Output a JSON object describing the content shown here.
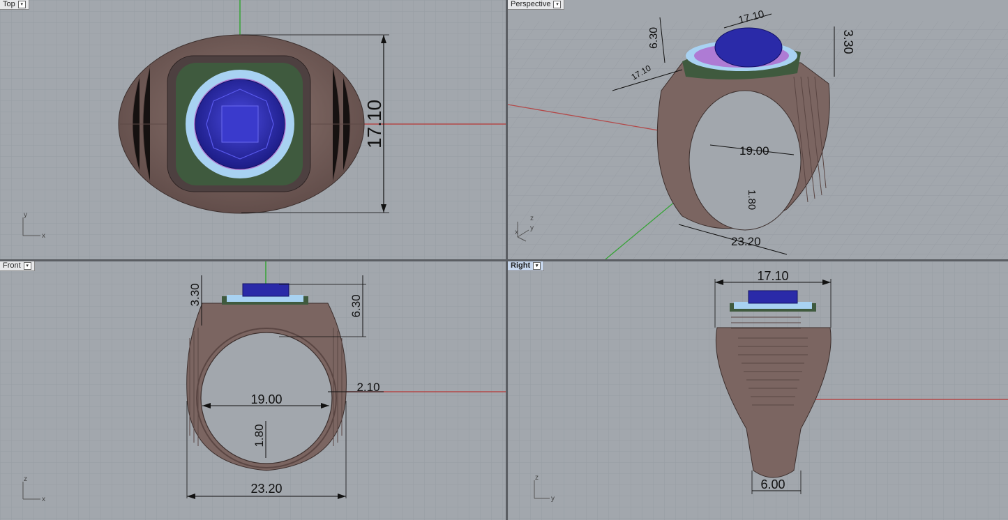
{
  "app": {
    "name": "Rhino 4-view viewport layout"
  },
  "viewports": {
    "top": {
      "title": "Top",
      "dims": {
        "height": "17.10"
      },
      "axes": {
        "a": "y",
        "b": "x"
      }
    },
    "perspective": {
      "title": "Perspective",
      "dims": {
        "top_width": "17.10",
        "left_height": "6.30",
        "right_height": "3.30",
        "depth": "17.10",
        "inner": "19.00",
        "thickness": "1.80",
        "outer": "23.20"
      },
      "axes": {
        "a": "z",
        "b": "y",
        "c": "x"
      }
    },
    "front": {
      "title": "Front",
      "dims": {
        "head_height": "3.30",
        "total_height": "6.30",
        "inner": "19.00",
        "wall": "2.10",
        "thickness": "1.80",
        "outer": "23.20"
      },
      "axes": {
        "a": "z",
        "b": "x"
      }
    },
    "right": {
      "title": "Right",
      "dims": {
        "top_width": "17.10",
        "bottom_width": "6.00"
      },
      "axes": {
        "a": "z",
        "b": "y"
      }
    }
  },
  "colors": {
    "grid_bg": "#a2a7ad",
    "grid_line": "#979ca3",
    "metal": "#7b6561",
    "stone": "#2a2aa8",
    "halo_light": "#a8d2f2",
    "halo_pink": "#b055c8",
    "axis_x": "#b34848",
    "axis_y": "#35a335"
  }
}
